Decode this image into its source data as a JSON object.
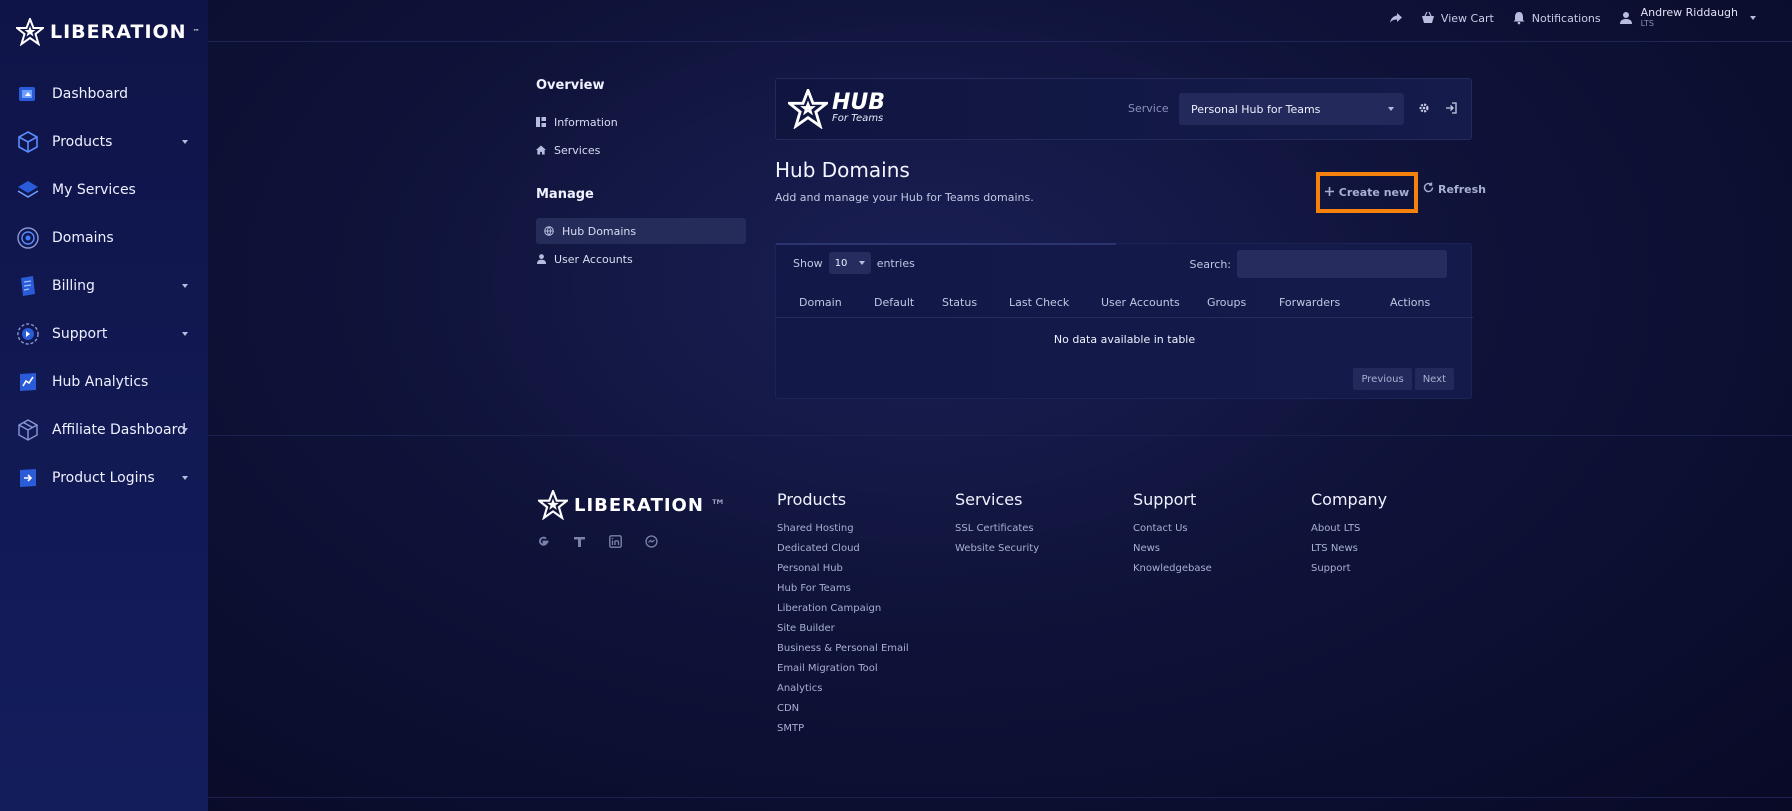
{
  "brand": {
    "name": "LIBERATION",
    "tm": "™"
  },
  "sidebar": {
    "items": [
      {
        "label": "Dashboard",
        "icon": "dashboard-icon",
        "caret": false
      },
      {
        "label": "Products",
        "icon": "cube-icon",
        "caret": true
      },
      {
        "label": "My Services",
        "icon": "layers-icon",
        "caret": false
      },
      {
        "label": "Domains",
        "icon": "globe-icon",
        "caret": false
      },
      {
        "label": "Billing",
        "icon": "billing-icon",
        "caret": true
      },
      {
        "label": "Support",
        "icon": "support-icon",
        "caret": true
      },
      {
        "label": "Hub Analytics",
        "icon": "analytics-icon",
        "caret": false
      },
      {
        "label": "Affiliate Dashboard",
        "icon": "box-icon",
        "caret": true
      },
      {
        "label": "Product Logins",
        "icon": "login-icon",
        "caret": true
      }
    ]
  },
  "topbar": {
    "view_cart": "View Cart",
    "notifications": "Notifications",
    "user_name": "Andrew Riddaugh",
    "user_org": "LTS"
  },
  "subnav": {
    "overview_title": "Overview",
    "overview_items": [
      "Information",
      "Services"
    ],
    "manage_title": "Manage",
    "manage_items": [
      "Hub Domains",
      "User Accounts"
    ]
  },
  "hub": {
    "logo_big": "HUB",
    "logo_small": "For Teams",
    "service_label": "Service",
    "service_value": "Personal Hub for Teams"
  },
  "page": {
    "title": "Hub Domains",
    "subtitle": "Add and manage your Hub for Teams domains.",
    "create_label": "Create new",
    "refresh_label": "Refresh"
  },
  "table": {
    "show_label": "Show",
    "length_value": "10",
    "entries_label": "entries",
    "search_label": "Search:",
    "columns": [
      "Domain",
      "Default",
      "Status",
      "Last Check",
      "User Accounts",
      "Groups",
      "Forwarders",
      "Actions"
    ],
    "empty_message": "No data available in table",
    "previous_label": "Previous",
    "next_label": "Next"
  },
  "footer": {
    "columns": [
      {
        "title": "Products",
        "links": [
          "Shared Hosting",
          "Dedicated Cloud",
          "Personal Hub",
          "Hub For Teams",
          "Liberation Campaign",
          "Site Builder",
          "Business & Personal Email",
          "Email Migration Tool",
          "Analytics",
          "CDN",
          "SMTP"
        ]
      },
      {
        "title": "Services",
        "links": [
          "SSL Certificates",
          "Website Security"
        ]
      },
      {
        "title": "Support",
        "links": [
          "Contact Us",
          "News",
          "Knowledgebase"
        ]
      },
      {
        "title": "Company",
        "links": [
          "About LTS",
          "LTS News",
          "Support"
        ]
      }
    ]
  },
  "colors": {
    "accent": "#f5820c",
    "sidebar_bg": "#121a55",
    "icon_blue": "#3d7bff"
  }
}
